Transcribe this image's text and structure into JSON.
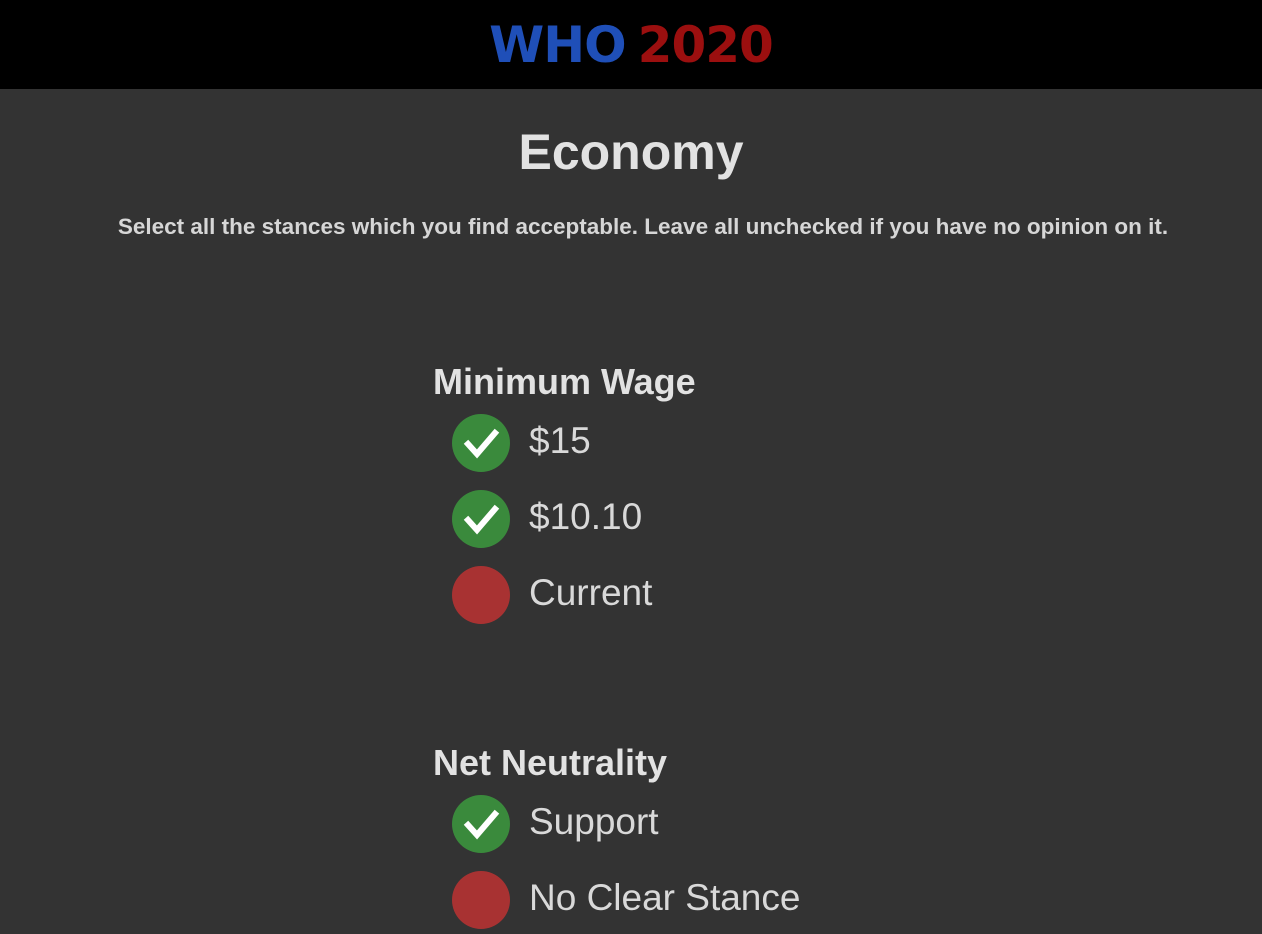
{
  "header": {
    "logo_part1": "WHO",
    "logo_part2": "2020",
    "logo_color1": "#1f4fb8",
    "logo_color2": "#9b0f0f",
    "background": "#000000"
  },
  "page": {
    "title": "Economy",
    "instructions": "Select all the stances which you find acceptable. Leave all unchecked if you have no opinion on it.",
    "background": "#333333"
  },
  "colors": {
    "checked": "#3a8a3c",
    "unchecked": "#a83232"
  },
  "sections": [
    {
      "title": "Minimum Wage",
      "options": [
        {
          "label": "$15",
          "checked": true,
          "icon": "check-icon"
        },
        {
          "label": "$10.10",
          "checked": true,
          "icon": "check-icon"
        },
        {
          "label": "Current",
          "checked": false,
          "icon": "unchecked-circle"
        }
      ]
    },
    {
      "title": "Net Neutrality",
      "options": [
        {
          "label": "Support",
          "checked": true,
          "icon": "check-icon"
        },
        {
          "label": "No Clear Stance",
          "checked": false,
          "icon": "unchecked-circle"
        }
      ]
    }
  ]
}
